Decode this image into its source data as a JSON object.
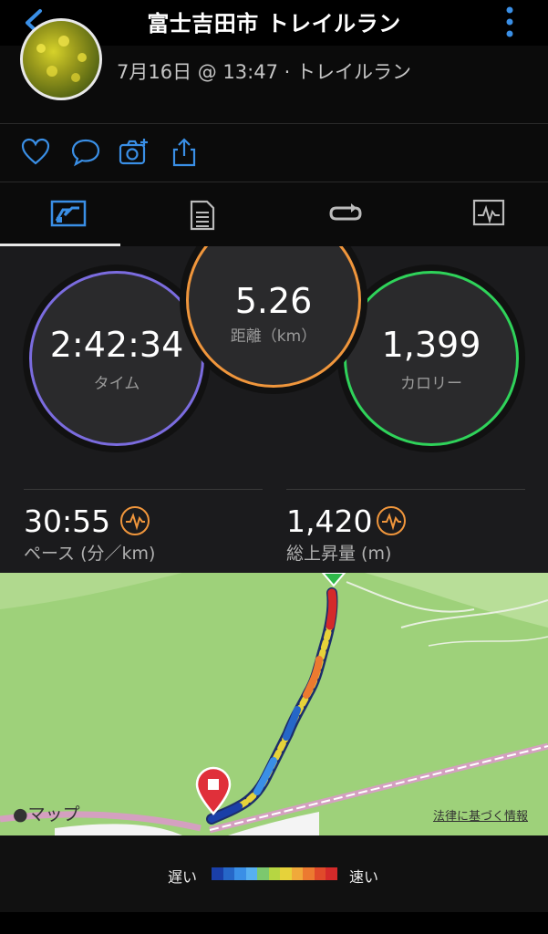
{
  "header": {
    "title": "富士吉田市 トレイルラン"
  },
  "activity": {
    "meta": "7月16日 @ 13:47 · トレイルラン"
  },
  "social": {
    "icons": [
      "heart-icon",
      "comment-icon",
      "add-photo-icon",
      "share-icon"
    ]
  },
  "tabs": [
    "overview-tab",
    "details-tab",
    "laps-tab",
    "charts-tab"
  ],
  "stats": {
    "time": {
      "value": "2:42:34",
      "label": "タイム"
    },
    "distance": {
      "value": "5.26",
      "label": "距離（km）"
    },
    "calories": {
      "value": "1,399",
      "label": "カロリー"
    },
    "pace": {
      "value": "30:55",
      "label": "ペース (分／km)"
    },
    "ascent": {
      "value": "1,420",
      "label": "総上昇量 (m)"
    }
  },
  "colors": {
    "time_ring": "#7b6cdf",
    "distance_ring": "#f0963c",
    "calories_ring": "#2fd35a",
    "accent_blue": "#3a8fe6"
  },
  "map": {
    "logo": "マップ",
    "legal": "法律に基づく情報"
  },
  "legend": {
    "slow": "遅い",
    "fast": "速い",
    "colors": [
      "#1a3fa8",
      "#2667c8",
      "#3a8fe6",
      "#57b0f0",
      "#7cc86e",
      "#b6d642",
      "#e6d23a",
      "#f0a93a",
      "#ec7a30",
      "#e04a2a",
      "#d42a2a"
    ]
  }
}
